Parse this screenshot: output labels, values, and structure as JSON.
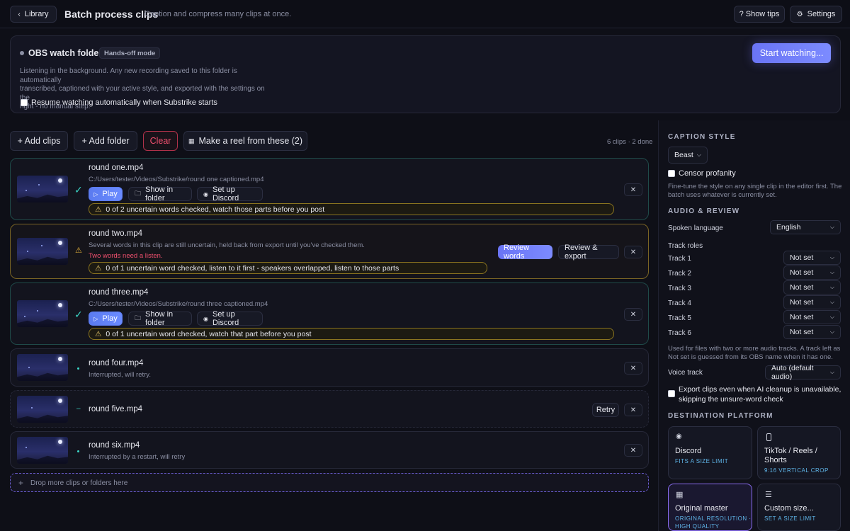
{
  "header": {
    "back_label": "Library",
    "title": "Batch process clips",
    "subtitle": "Caption and compress many clips at once.",
    "tips_label": "? Show tips",
    "settings_label": "Settings"
  },
  "watch": {
    "title": "OBS watch folder",
    "badge": "Hands-off mode",
    "desc1": "Listening in the background. Any new recording saved to this folder is automatically",
    "desc2": "transcribed, captioned with your active style, and exported with the settings on the",
    "desc3": "right - no manual step.",
    "resume_label": "Resume watching automatically when Substrike starts",
    "resume_checked": false,
    "start_label": "Start watching..."
  },
  "toolbar": {
    "add_clips": "+ Add clips",
    "add_folder": "+ Add folder",
    "clear": "Clear",
    "reel": "Make a reel from these (2)",
    "count": "6 clips · 2 done"
  },
  "clips": [
    {
      "name": "round one.mp4",
      "path": "C:/Users/tester/Videos/Substrike/round one captioned.mp4",
      "status_icon": "check-icon",
      "play": "Play",
      "show": "Show in folder",
      "discord": "Set up Discord",
      "warning": "0 of 2 uncertain words checked, watch those parts before you post"
    },
    {
      "name": "round two.mp4",
      "desc": "Several words in this clip are still uncertain, held back from export until you've checked them.",
      "alert": "Two words need a listen.",
      "status_icon": "warning-icon",
      "review_words": "Review words",
      "review_export": "Review & export",
      "warning": "0 of 1 uncertain word checked, listen to it first - speakers overlapped, listen to those parts"
    },
    {
      "name": "round three.mp4",
      "path": "C:/Users/tester/Videos/Substrike/round three captioned.mp4",
      "status_icon": "check-icon",
      "play": "Play",
      "show": "Show in folder",
      "discord": "Set up Discord",
      "warning": "0 of 1 uncertain word checked, watch that part before you post"
    },
    {
      "name": "round four.mp4",
      "desc": "Interrupted, will retry.",
      "status_icon": "dot-icon"
    },
    {
      "name": "round five.mp4",
      "status_icon": "dash-icon",
      "retry": "Retry"
    },
    {
      "name": "round six.mp4",
      "desc": "Interrupted by a restart, will retry",
      "status_icon": "dot-icon"
    }
  ],
  "dropzone": "Drop more clips or folders here",
  "sidebar": {
    "caption_heading": "CAPTION STYLE",
    "style_value": "Beast",
    "censor_label": "Censor profanity",
    "censor_checked": false,
    "style_note1": "Fine-tune the style on any single clip in the editor first. The",
    "style_note2": "batch uses whatever is currently set.",
    "audio_heading": "AUDIO & REVIEW",
    "spoken_label": "Spoken language",
    "spoken_value": "English",
    "roles_label": "Track roles",
    "tracks": [
      {
        "label": "Track 1",
        "value": "Not set"
      },
      {
        "label": "Track 2",
        "value": "Not set"
      },
      {
        "label": "Track 3",
        "value": "Not set"
      },
      {
        "label": "Track 4",
        "value": "Not set"
      },
      {
        "label": "Track 5",
        "value": "Not set"
      },
      {
        "label": "Track 6",
        "value": "Not set"
      }
    ],
    "tracks_note1": "Used for files with two or more audio tracks. A track left as",
    "tracks_note2": "Not set is guessed from its OBS name when it has one.",
    "voice_label": "Voice track",
    "voice_value": "Auto (default audio)",
    "export_label1": "Export clips even when AI cleanup is unavailable,",
    "export_label2": "skipping the unsure-word check",
    "export_checked": false,
    "dest_heading": "DESTINATION PLATFORM",
    "platforms": [
      {
        "title": "Discord",
        "sub": "FITS A SIZE LIMIT",
        "icon": "discord-icon"
      },
      {
        "title": "TikTok / Reels /",
        "title2": "Shorts",
        "sub": "9:16 VERTICAL CROP",
        "icon": "phone-icon"
      },
      {
        "title": "Original master",
        "sub": "ORIGINAL RESOLUTION ·",
        "sub2": "HIGH QUALITY",
        "icon": "grid-icon",
        "selected": true
      },
      {
        "title": "Custom size...",
        "sub": "SET A SIZE LIMIT",
        "icon": "sliders-icon"
      }
    ]
  },
  "colors": {
    "accent": "#6a8bff",
    "warning": "#e3c46a",
    "success": "#3bd6c6",
    "danger": "#f0506e",
    "selected_border": "#8a6cf0"
  }
}
